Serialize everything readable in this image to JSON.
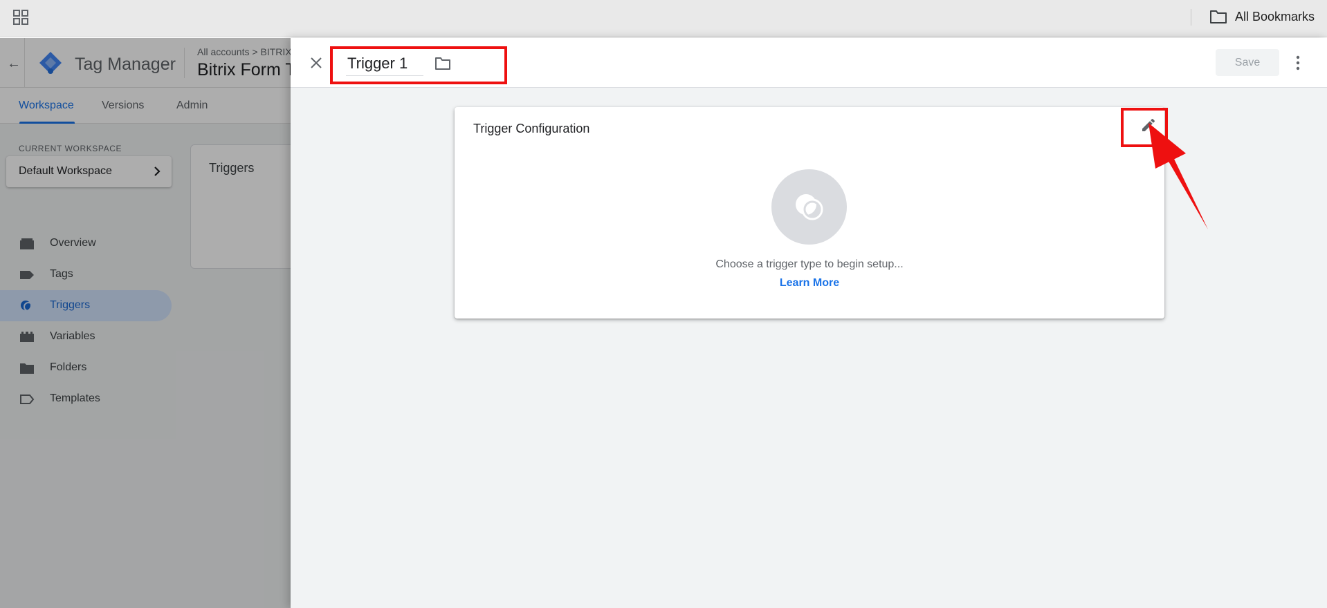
{
  "browser": {
    "bookmarks_label": "All Bookmarks",
    "icons": {
      "apps": "apps-grid-icon",
      "bookmarks_folder": "folder-icon"
    }
  },
  "gtm": {
    "product_name": "Tag Manager",
    "breadcrumb": "All accounts  >  BITRIX",
    "container_name": "Bitrix Form T",
    "tabs": [
      {
        "label": "Workspace",
        "active": true
      },
      {
        "label": "Versions",
        "active": false
      },
      {
        "label": "Admin",
        "active": false
      }
    ],
    "current_workspace_label": "CURRENT WORKSPACE",
    "workspace_name": "Default Workspace",
    "nav": [
      {
        "label": "Overview",
        "icon": "overview-icon",
        "active": false
      },
      {
        "label": "Tags",
        "icon": "tag-icon",
        "active": false
      },
      {
        "label": "Triggers",
        "icon": "trigger-icon",
        "active": true
      },
      {
        "label": "Variables",
        "icon": "variables-icon",
        "active": false
      },
      {
        "label": "Folders",
        "icon": "folder-icon",
        "active": false
      },
      {
        "label": "Templates",
        "icon": "template-icon",
        "active": false
      }
    ],
    "triggers_card_title": "Triggers"
  },
  "editor": {
    "trigger_name": "Trigger 1",
    "save_label": "Save",
    "save_enabled": false,
    "config_card": {
      "title": "Trigger Configuration",
      "hint": "Choose a trigger type to begin setup...",
      "learn_more": "Learn More"
    }
  },
  "colors": {
    "accent": "#1a73e8",
    "annotation_red": "#ee1010",
    "active_nav_bg": "#d2e3fc",
    "panel_bg": "#f1f3f4"
  }
}
